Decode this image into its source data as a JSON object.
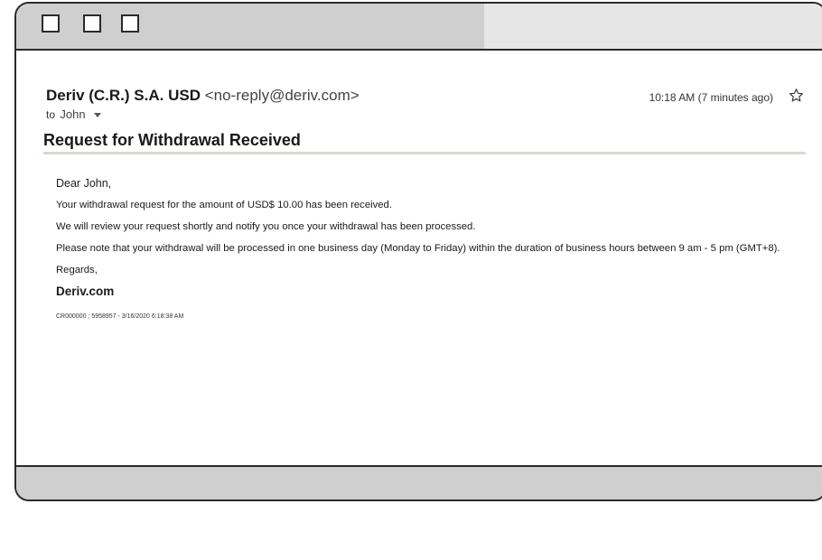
{
  "window": {
    "buttons": [
      "square",
      "square",
      "square"
    ]
  },
  "email": {
    "sender_name": "Deriv (C.R.) S.A. USD",
    "sender_email": "<no-reply@deriv.com>",
    "to_label": "to",
    "to_name": "John",
    "timestamp": "10:18 AM (7 minutes ago)",
    "star_icon": "star-outline-icon",
    "subject": "Request for Withdrawal Received",
    "body": {
      "greeting_prefix": "Dear ",
      "greeting_name": "John,",
      "line1": "Your withdrawal request for the amount of USD$ 10.00 has been received.",
      "line2": "We will review your request shortly and notify you once your withdrawal has been processed.",
      "line3": "Please note that your withdrawal will be processed in one business day (Monday to Friday) within the duration of business hours between 9 am - 5 pm (GMT+8).",
      "regards": "Regards,",
      "signature": "Deriv.com",
      "reference": "CR000000 ; 5958957 - 3/16/2020 6:18:38 AM"
    }
  },
  "colors": {
    "frame": "#2a2a2a",
    "titlebar": "#cfcfcf",
    "tab": "#e6e6e6",
    "divider": "#d9d9cf"
  }
}
